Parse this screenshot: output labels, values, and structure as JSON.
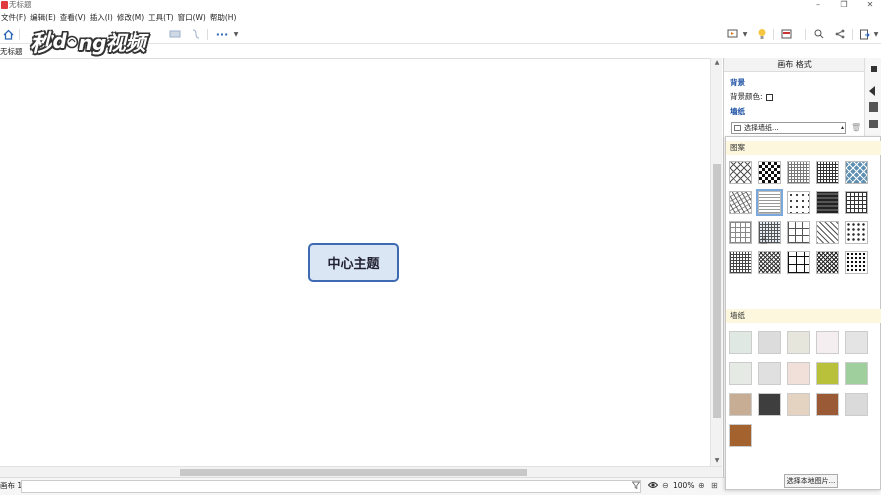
{
  "window": {
    "title": "无标题",
    "controls": [
      "minimize-icon",
      "restore-icon",
      "close-icon"
    ]
  },
  "menu": [
    {
      "label": "文件(F)"
    },
    {
      "label": "编辑(E)"
    },
    {
      "label": "查看(V)"
    },
    {
      "label": "插入(I)"
    },
    {
      "label": "修改(M)"
    },
    {
      "label": "工具(T)"
    },
    {
      "label": "窗口(W)"
    },
    {
      "label": "帮助(H)"
    }
  ],
  "toolbar": {
    "more_label": "···",
    "icons": [
      "home-icon",
      "more-icon",
      "present-icon",
      "idea-icon",
      "view-icon",
      "search-icon",
      "share-icon",
      "export-icon"
    ]
  },
  "watermark": {
    "part1": "秒",
    "part2": "d",
    "part3": "ng视频"
  },
  "document": {
    "tab_label": "无标题"
  },
  "canvas": {
    "central_topic": "中心主题"
  },
  "statusbar": {
    "sheet_label": "画布 1",
    "zoom": "100%"
  },
  "panel": {
    "title": "画布 格式",
    "background_section": "背景",
    "background_color_label": "背景颜色:",
    "wallpaper_section": "墙纸",
    "wallpaper_select_label": "选择墙纸..."
  },
  "popup": {
    "patterns_title": "图案",
    "wallpapers_title": "墙纸",
    "local_image_button": "选择本地图片...",
    "pattern_count": 20,
    "selected_pattern_index": 6,
    "wallpaper_colors": [
      "#dfe8e3",
      "#dcdcdc",
      "#e6e6dc",
      "#f5eef0",
      "#e4e4e4",
      "#e5ebe4",
      "#e0e0e0",
      "#f1e0da",
      "#b9c13a",
      "#9fcf9c",
      "#c8ad95",
      "#3e3e3e",
      "#e3d3c0",
      "#9a5a36",
      "#dadada",
      "#a4622f"
    ]
  },
  "colors": {
    "topic_fill": "#dbe6f4",
    "topic_border": "#3d6ab2",
    "section_title": "#1a4fa3",
    "popup_header": "#fdf8dd",
    "app_red": "#e0393e"
  }
}
